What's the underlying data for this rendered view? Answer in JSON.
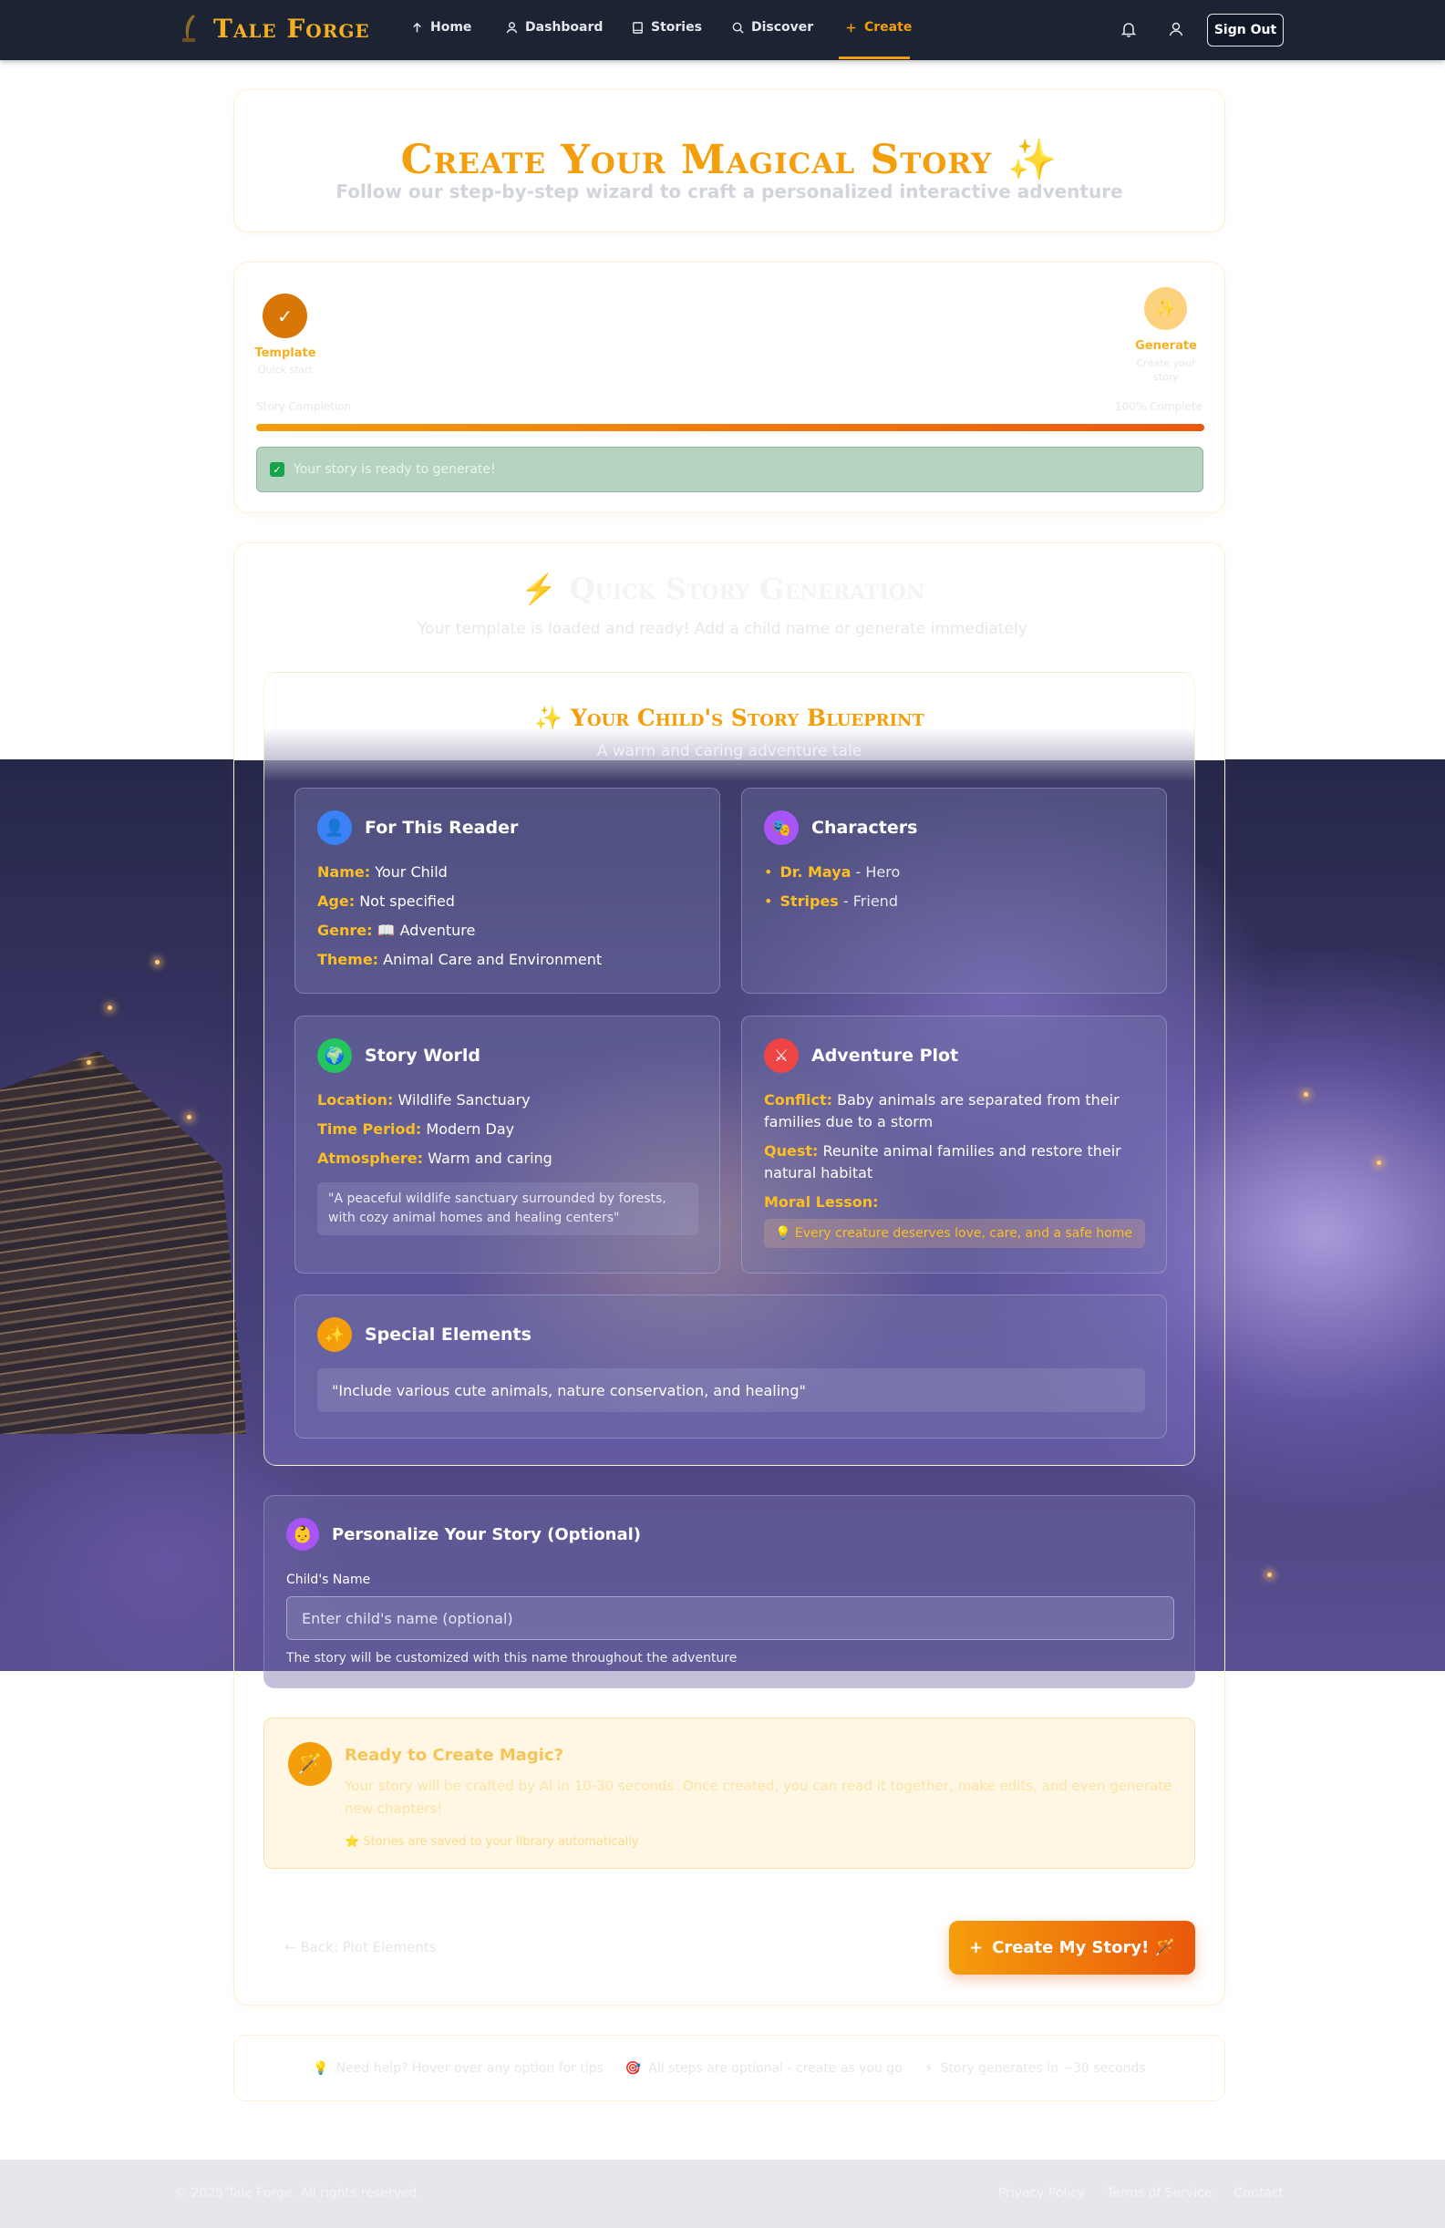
{
  "nav": {
    "brand": "Tale Forge",
    "items": [
      {
        "label": "Home",
        "icon": "arrow-up-icon"
      },
      {
        "label": "Dashboard",
        "icon": "user-icon"
      },
      {
        "label": "Stories",
        "icon": "book-icon"
      },
      {
        "label": "Discover",
        "icon": "search-icon"
      },
      {
        "label": "Create",
        "icon": "plus-icon"
      }
    ],
    "signout": "Sign Out",
    "accent": "#f59e0b"
  },
  "hero": {
    "title": "Create Your Magical Story ✨",
    "subtitle": "Follow our step-by-step wizard to craft a personalized interactive adventure"
  },
  "progress": {
    "steps": [
      {
        "label": "Template",
        "sub": "Quick start"
      },
      {
        "label": "Generate",
        "sub": "Create your story"
      }
    ],
    "left_label": "Story Completion",
    "right_label": "100% Complete",
    "percent": 100,
    "ready_text": "Your story is ready to generate!"
  },
  "quick": {
    "title": "Quick Story Generation",
    "subtitle": "Your template is loaded and ready! Add a child name or generate immediately"
  },
  "blueprint": {
    "title": "Your Child's Story Blueprint",
    "subtitle": "A warm and caring adventure tale",
    "reader": {
      "title": "For This Reader",
      "name_k": "Name:",
      "name_v": "Your Child",
      "age_k": "Age:",
      "age_v": "Not specified",
      "genre_k": "Genre:",
      "genre_v": "📖 Adventure",
      "theme_k": "Theme:",
      "theme_v": "Animal Care and Environment"
    },
    "characters": {
      "title": "Characters",
      "list": [
        {
          "name": "Dr. Maya",
          "role": "- Hero"
        },
        {
          "name": "Stripes",
          "role": "- Friend"
        }
      ]
    },
    "world": {
      "title": "Story World",
      "loc_k": "Location:",
      "loc_v": "Wildlife Sanctuary",
      "time_k": "Time Period:",
      "time_v": "Modern Day",
      "atm_k": "Atmosphere:",
      "atm_v": "Warm and caring",
      "quote": "\"A peaceful wildlife sanctuary surrounded by forests, with cozy animal homes and healing centers\""
    },
    "plot": {
      "title": "Adventure Plot",
      "conflict_k": "Conflict:",
      "conflict_v": "Baby animals are separated from their families due to a storm",
      "quest_k": "Quest:",
      "quest_v": "Reunite animal families and restore their natural habitat",
      "moral_k": "Moral Lesson:",
      "moral_v": "💡 Every creature deserves love, care, and a safe home"
    },
    "special": {
      "title": "Special Elements",
      "quote": "\"Include various cute animals, nature conservation, and healing\""
    }
  },
  "personalize": {
    "title": "Personalize Your Story (Optional)",
    "label": "Child's Name",
    "placeholder": "Enter child's name (optional)",
    "value": "",
    "hint": "The story will be customized with this name throughout the adventure"
  },
  "magic": {
    "title": "Ready to Create Magic?",
    "body": "Your story will be crafted by AI in 10-30 seconds. Once created, you can read it together, make edits, and even generate new chapters!",
    "note": "⭐ Stories are saved to your library automatically"
  },
  "actions": {
    "back": "← Back: Plot Elements",
    "create": "Create My Story! 🪄"
  },
  "tips": [
    {
      "icon": "💡",
      "text": "Need help? Hover over any option for tips"
    },
    {
      "icon": "🎯",
      "text": "All steps are optional - create as you go"
    },
    {
      "icon": "⚡",
      "text": "Story generates in ~30 seconds"
    }
  ],
  "footer": {
    "copyright": "© 2025 Tale Forge. All rights reserved.",
    "links": [
      "Privacy Policy",
      "Terms of Service",
      "Contact"
    ]
  }
}
